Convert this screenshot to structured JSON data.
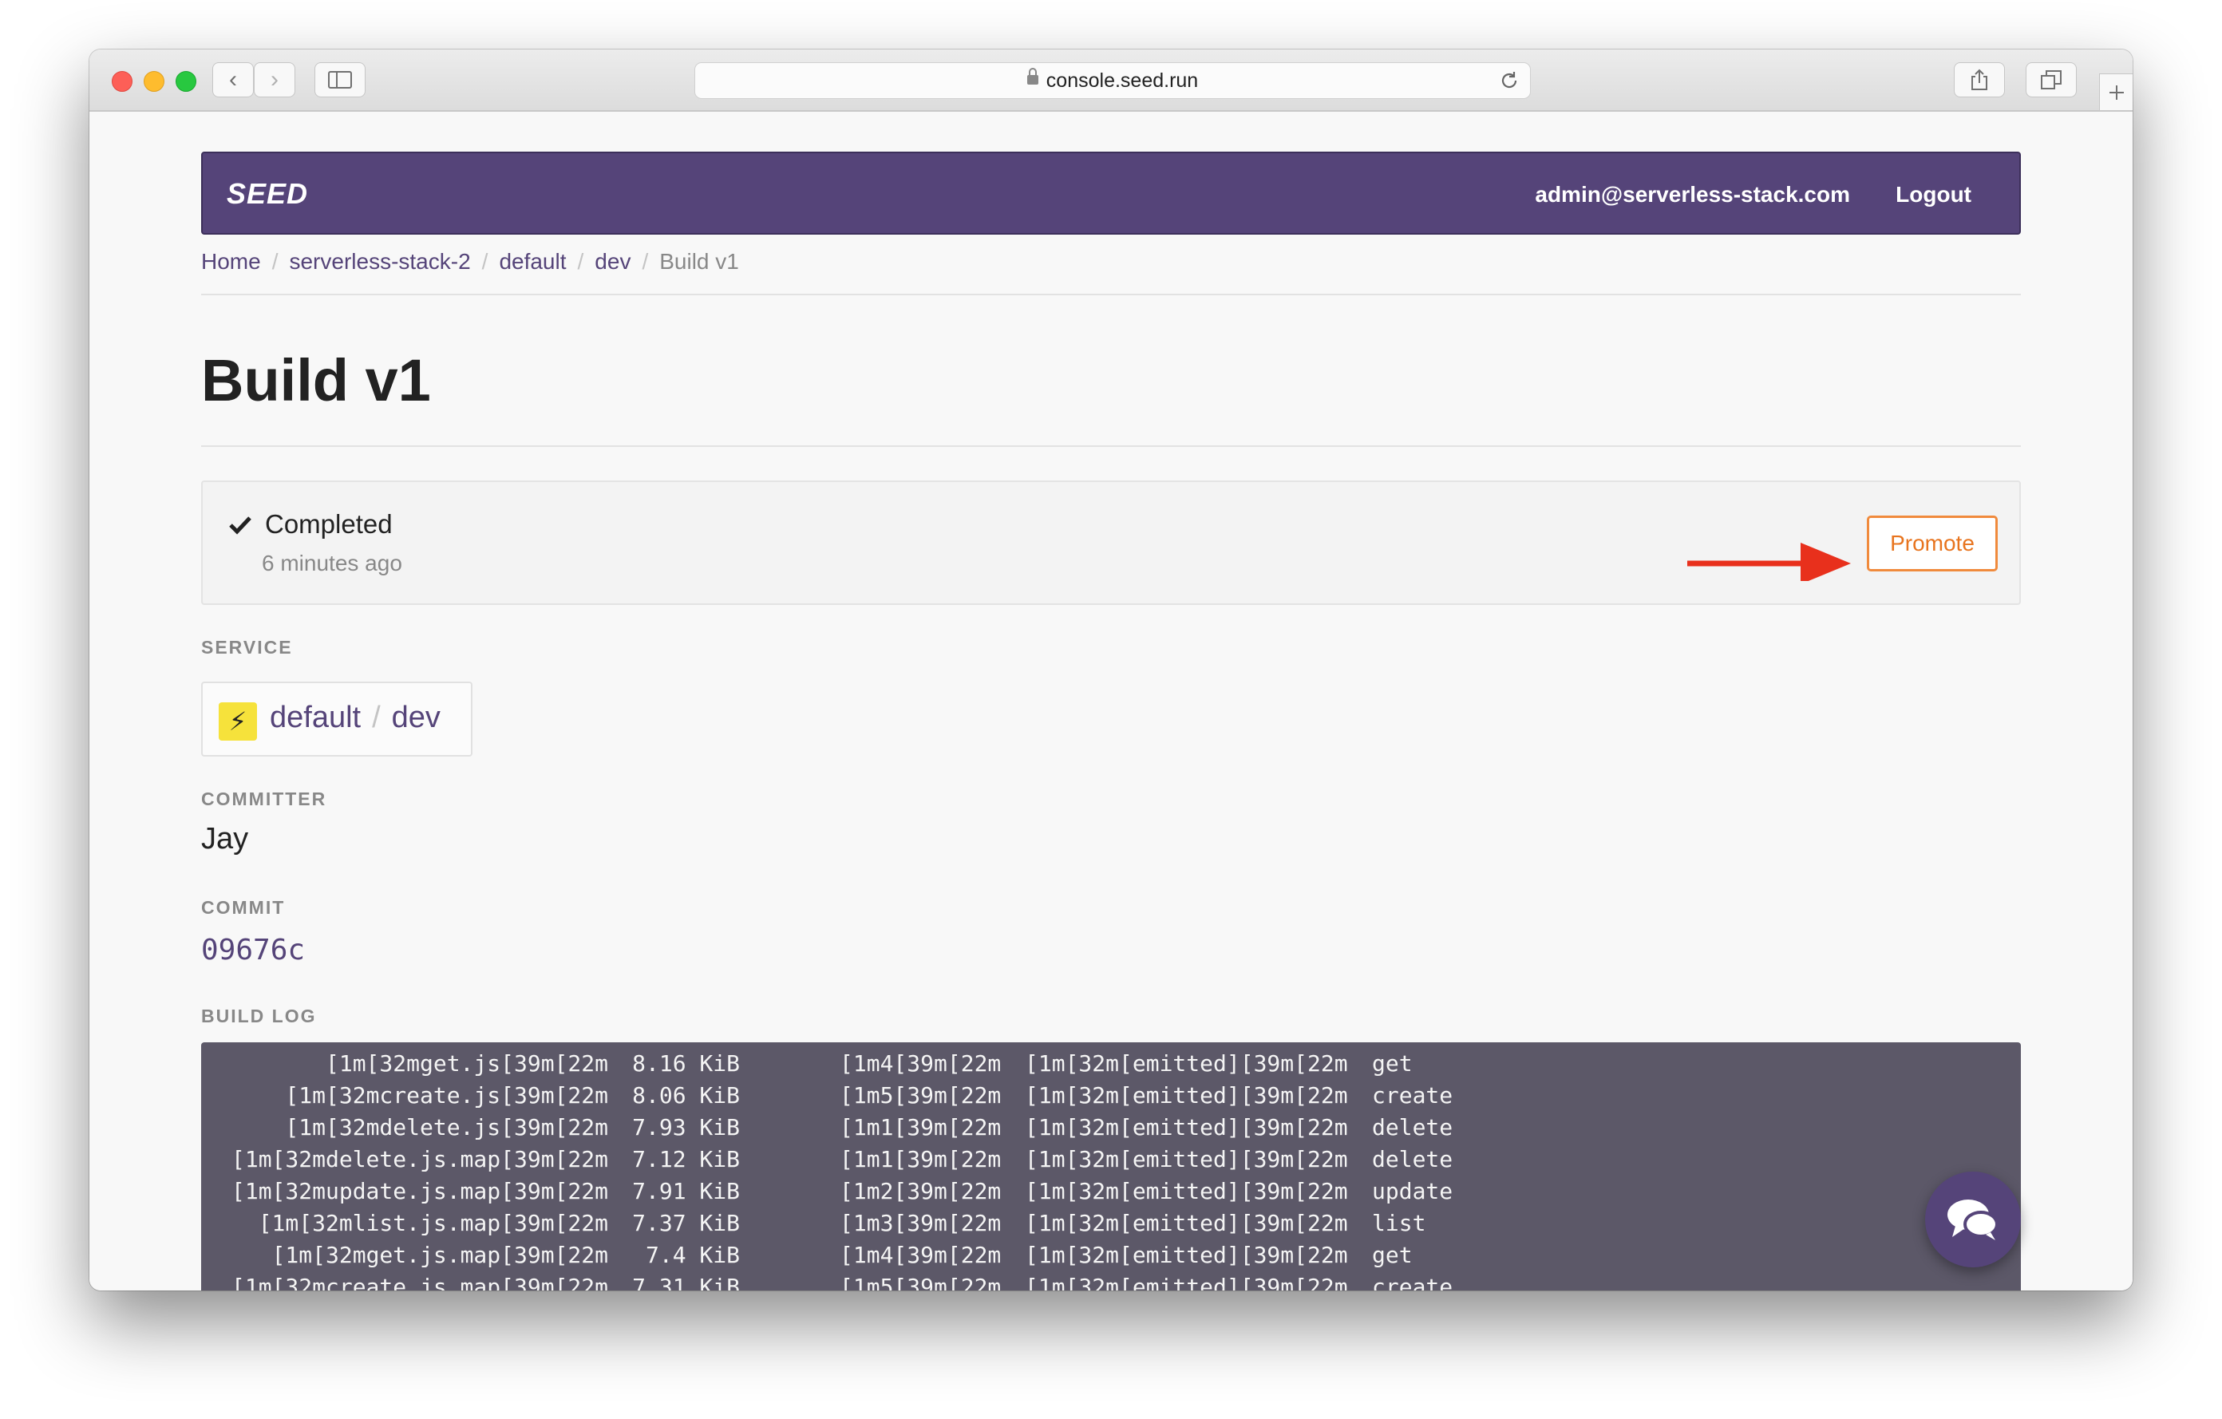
{
  "browser": {
    "url": "console.seed.run",
    "back_icon": "‹",
    "forward_icon": "›"
  },
  "navbar": {
    "brand": "SEED",
    "user": "admin@serverless-stack.com",
    "logout": "Logout"
  },
  "breadcrumb": [
    {
      "label": "Home"
    },
    {
      "label": "serverless-stack-2"
    },
    {
      "label": "default"
    },
    {
      "label": "dev"
    },
    {
      "label": "Build v1"
    }
  ],
  "page": {
    "title": "Build v1"
  },
  "status": {
    "label": "Completed",
    "time": "6 minutes ago",
    "promote_label": "Promote"
  },
  "service": {
    "heading": "SERVICE",
    "name": "default",
    "stage": "dev"
  },
  "committer": {
    "heading": "COMMITTER",
    "name": "Jay"
  },
  "commit": {
    "heading": "COMMIT",
    "hash": "09676c"
  },
  "build_log": {
    "heading": "BUILD LOG",
    "rows": [
      [
        "[1m[32mget.js[39m[22m",
        "8.16 KiB",
        "[1m4[39m[22m",
        "[1m[32m[emitted][39m[22m",
        "get"
      ],
      [
        "[1m[32mcreate.js[39m[22m",
        "8.06 KiB",
        "[1m5[39m[22m",
        "[1m[32m[emitted][39m[22m",
        "create"
      ],
      [
        "[1m[32mdelete.js[39m[22m",
        "7.93 KiB",
        "[1m1[39m[22m",
        "[1m[32m[emitted][39m[22m",
        "delete"
      ],
      [
        "[1m[32mdelete.js.map[39m[22m",
        "7.12 KiB",
        "[1m1[39m[22m",
        "[1m[32m[emitted][39m[22m",
        "delete"
      ],
      [
        "[1m[32mupdate.js.map[39m[22m",
        "7.91 KiB",
        "[1m2[39m[22m",
        "[1m[32m[emitted][39m[22m",
        "update"
      ],
      [
        "[1m[32mlist.js.map[39m[22m",
        "7.37 KiB",
        "[1m3[39m[22m",
        "[1m[32m[emitted][39m[22m",
        "list"
      ],
      [
        "[1m[32mget.js.map[39m[22m",
        "7.4 KiB",
        "[1m4[39m[22m",
        "[1m[32m[emitted][39m[22m",
        "get"
      ],
      [
        "[1m[32mcreate.js.map[39m[22m",
        "7.31 KiB",
        "[1m5[39m[22m",
        "[1m[32m[emitted][39m[22m",
        "create"
      ]
    ]
  },
  "colors": {
    "brand_purple": "#554479",
    "promote_orange": "#e8741e",
    "log_bg": "#5c5868",
    "arrow_red": "#e8301c"
  }
}
